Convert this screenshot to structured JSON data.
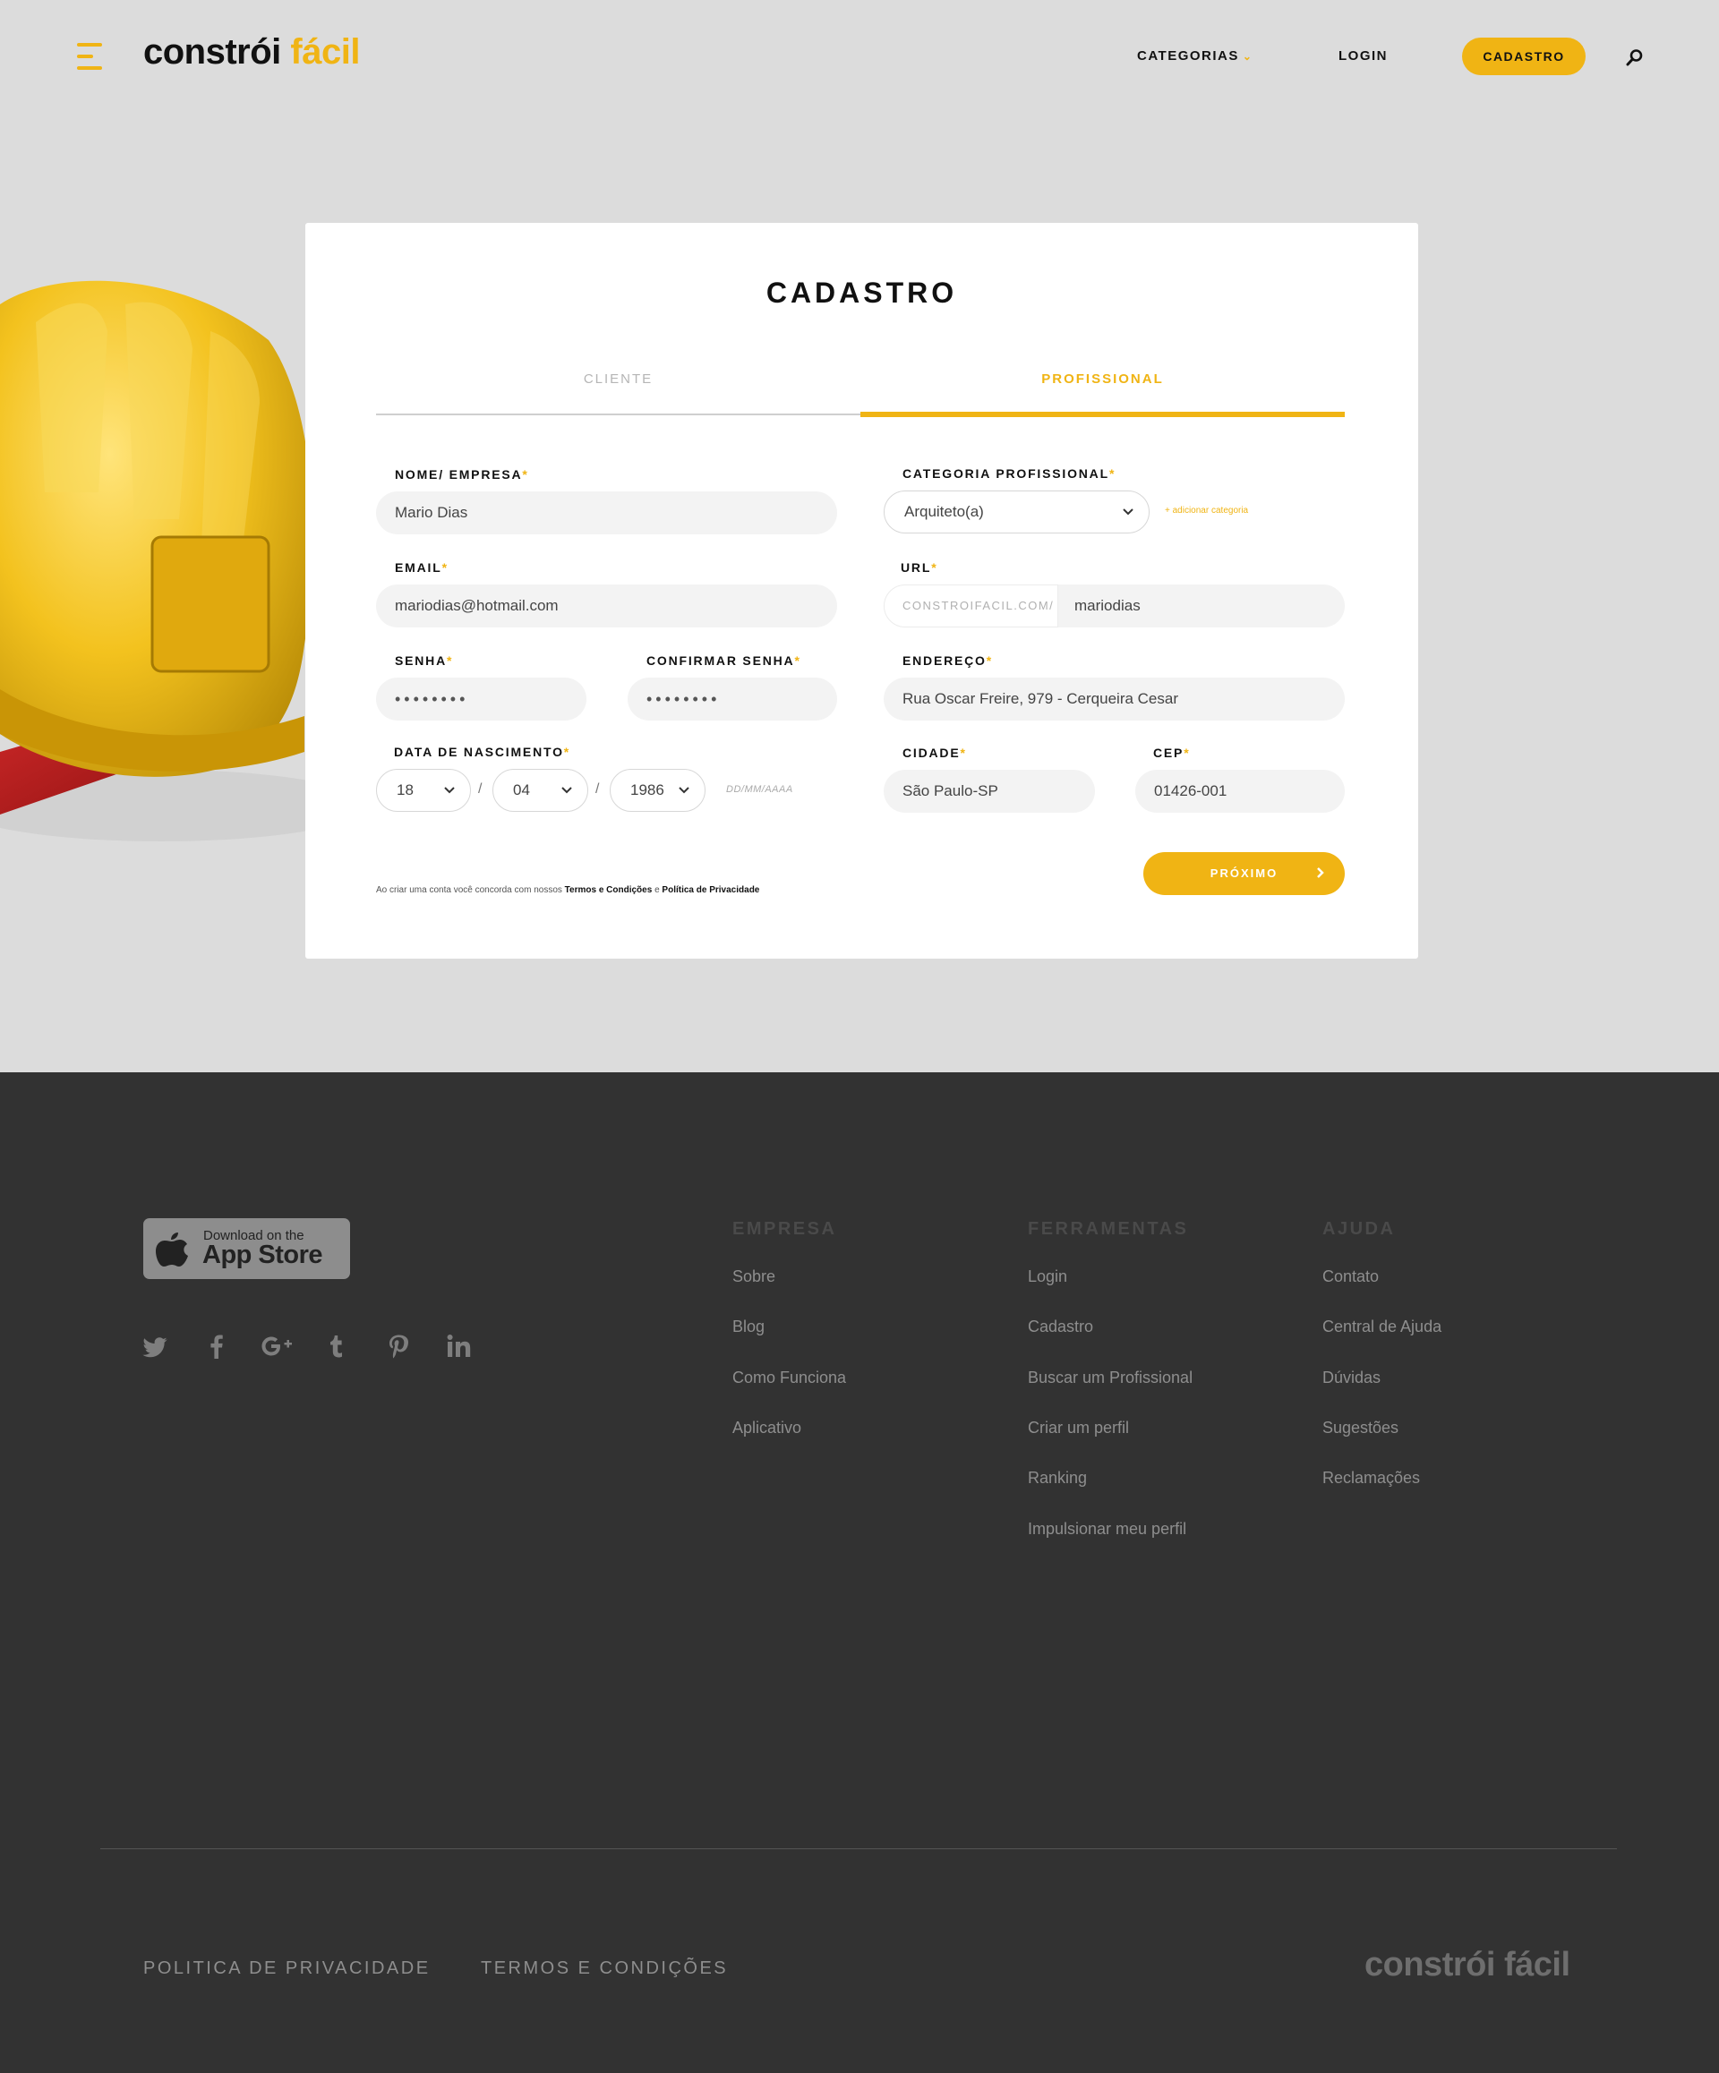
{
  "header": {
    "logo_part1": "constrói",
    "logo_part2": "fácil",
    "nav_categories": "CATEGORIAS",
    "nav_login": "LOGIN",
    "nav_cadastro": "CADASTRO"
  },
  "form": {
    "title": "CADASTRO",
    "tabs": [
      {
        "label": "CLIENTE",
        "active": false
      },
      {
        "label": "PROFISSIONAL",
        "active": true
      }
    ],
    "name_label": "NOME/ EMPRESA",
    "name_value": "Mario Dias",
    "email_label": "EMAIL",
    "email_value": "mariodias@hotmail.com",
    "password_label": "SENHA",
    "password_value": "••••••••",
    "confirm_label": "CONFIRMAR SENHA",
    "confirm_value": "••••••••",
    "birth_label": "DATA DE NASCIMENTO",
    "birth_day": "18",
    "birth_month": "04",
    "birth_year": "1986",
    "date_sep": "/",
    "date_hint": "DD/MM/AAAA",
    "category_label": "CATEGORIA PROFISSIONAL",
    "category_value": "Arquiteto(a)",
    "add_category": "+ adicionar categoria",
    "url_label": "URL",
    "url_prefix": "CONSTROIFACIL.COM/",
    "url_value": "mariodias",
    "address_label": "ENDEREÇO",
    "address_value": "Rua Oscar Freire, 979 - Cerqueira Cesar",
    "city_label": "CIDADE",
    "city_value": "São Paulo-SP",
    "cep_label": "CEP",
    "cep_value": "01426-001",
    "required_mark": "*",
    "terms_text": "Ao criar uma conta você concorda com nossos",
    "terms_link": "Termos e Condições",
    "terms_and": "e",
    "privacy_link": "Política de Privacidade",
    "next_button": "PRÓXIMO"
  },
  "footer": {
    "appstore_small": "Download on the",
    "appstore_big": "App Store",
    "social": [
      "twitter-icon",
      "facebook-icon",
      "google-plus-icon",
      "tumblr-icon",
      "pinterest-icon",
      "linkedin-icon"
    ],
    "columns": [
      {
        "heading": "EMPRESA",
        "links": [
          "Sobre",
          "Blog",
          "Como Funciona",
          "Aplicativo"
        ]
      },
      {
        "heading": "FERRAMENTAS",
        "links": [
          "Login",
          "Cadastro",
          "Buscar um Profissional",
          "Criar um perfil",
          "Ranking",
          "Impulsionar meu perfil"
        ]
      },
      {
        "heading": "AJUDA",
        "links": [
          "Contato",
          "Central de Ajuda",
          "Dúvidas",
          "Sugestões",
          "Reclamações"
        ]
      }
    ],
    "privacy": "POLITICA DE PRIVACIDADE",
    "terms": "TERMOS E CONDIÇÕES",
    "logo": "constrói fácil"
  },
  "colors": {
    "accent": "#f0b414",
    "background": "#dcdcdc",
    "footer_bg": "#323232"
  }
}
